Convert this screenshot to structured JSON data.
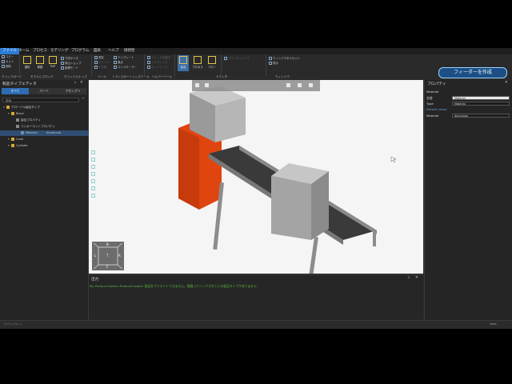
{
  "menubar": [
    "ファイル",
    "ホーム",
    "プロセス",
    "モデリング",
    "プログラム",
    "図表",
    "ヘルプ",
    "接続性"
  ],
  "ribbon": {
    "clipboard_small": [
      "コピー",
      "カット",
      "削除"
    ],
    "clipboard_label": "クリップボード",
    "select_buttons": [
      "選択",
      "移動",
      "PnP"
    ],
    "select_small": [
      "寸法サイズ",
      "静止ショップ",
      "座標モード"
    ],
    "select_label": "モデルとブロック",
    "grid_label": "グリッドスナップ",
    "tools_small": [
      "測定",
      "ポイント",
      "その他"
    ],
    "tools_label": "ツール",
    "measure_small": [
      "テンプレート",
      "原点",
      "コントローラー"
    ],
    "measure_small_b": [
      "ワークピース",
      "Xcoordinate",
      "設定変更"
    ],
    "transport_label": "トランスポートレンズツール",
    "helper_small": [
      "フレームを追加",
      "トラフィック",
      "ネットワーク"
    ],
    "helper_label": "ヘルパーツール",
    "editor_buttons": [
      "製品",
      "プロセス",
      "フロー"
    ],
    "editor_label": "エディタ",
    "right_small": [
      "ウィンドウのリセット",
      "表示"
    ],
    "window_small": "アウトウィンドウ",
    "window_label": "ウィンドウ",
    "create_feeder": "フィーダーを作成"
  },
  "left_panel": {
    "title": "製品タイプエディタ",
    "tabs": [
      "すべて",
      "パーツ",
      "アセンブリ"
    ],
    "search_placeholder": "検索",
    "tree": [
      {
        "label": "グローバル製品タイプ",
        "depth": 0,
        "icon": "folder-icon"
      },
      {
        "label": "Block",
        "depth": 1,
        "icon": "folder-icon"
      },
      {
        "label": "製品プロパティ",
        "depth": 2,
        "icon": "property-icon"
      },
      {
        "label": "コンポーネントプロパティ",
        "depth": 2,
        "icon": "property-icon"
      },
      {
        "label": "Material",
        "depth": 3,
        "icon": "material-icon",
        "value": "Aluminum",
        "selected": true
      },
      {
        "label": "Cone",
        "depth": 1,
        "icon": "folder-icon"
      },
      {
        "label": "Cylinder",
        "depth": 1,
        "icon": "folder-icon"
      }
    ]
  },
  "properties": {
    "title": "プロパティ",
    "section": "Material",
    "fields": [
      {
        "label": "名前",
        "value": "Material"
      },
      {
        "label": "Type",
        "value": "Material"
      },
      {
        "label": "Default Value",
        "value": ""
      },
      {
        "label": "Material",
        "value": "Aluminum"
      }
    ]
  },
  "output": {
    "title": "出力",
    "message": "My Product Feeder::ProductCreator: 製品をクリエイトできません。間違ってリンクされている製品タイプがありません"
  },
  "viewport": {
    "cube_faces": [
      "B",
      "L",
      "T",
      "R",
      "F"
    ]
  },
  "status": {
    "left": "アクティブプレイ",
    "right": "100%"
  },
  "colors": {
    "accent": "#2e6db4",
    "orange_box": "#e0450f",
    "output_text": "#59b83d"
  }
}
